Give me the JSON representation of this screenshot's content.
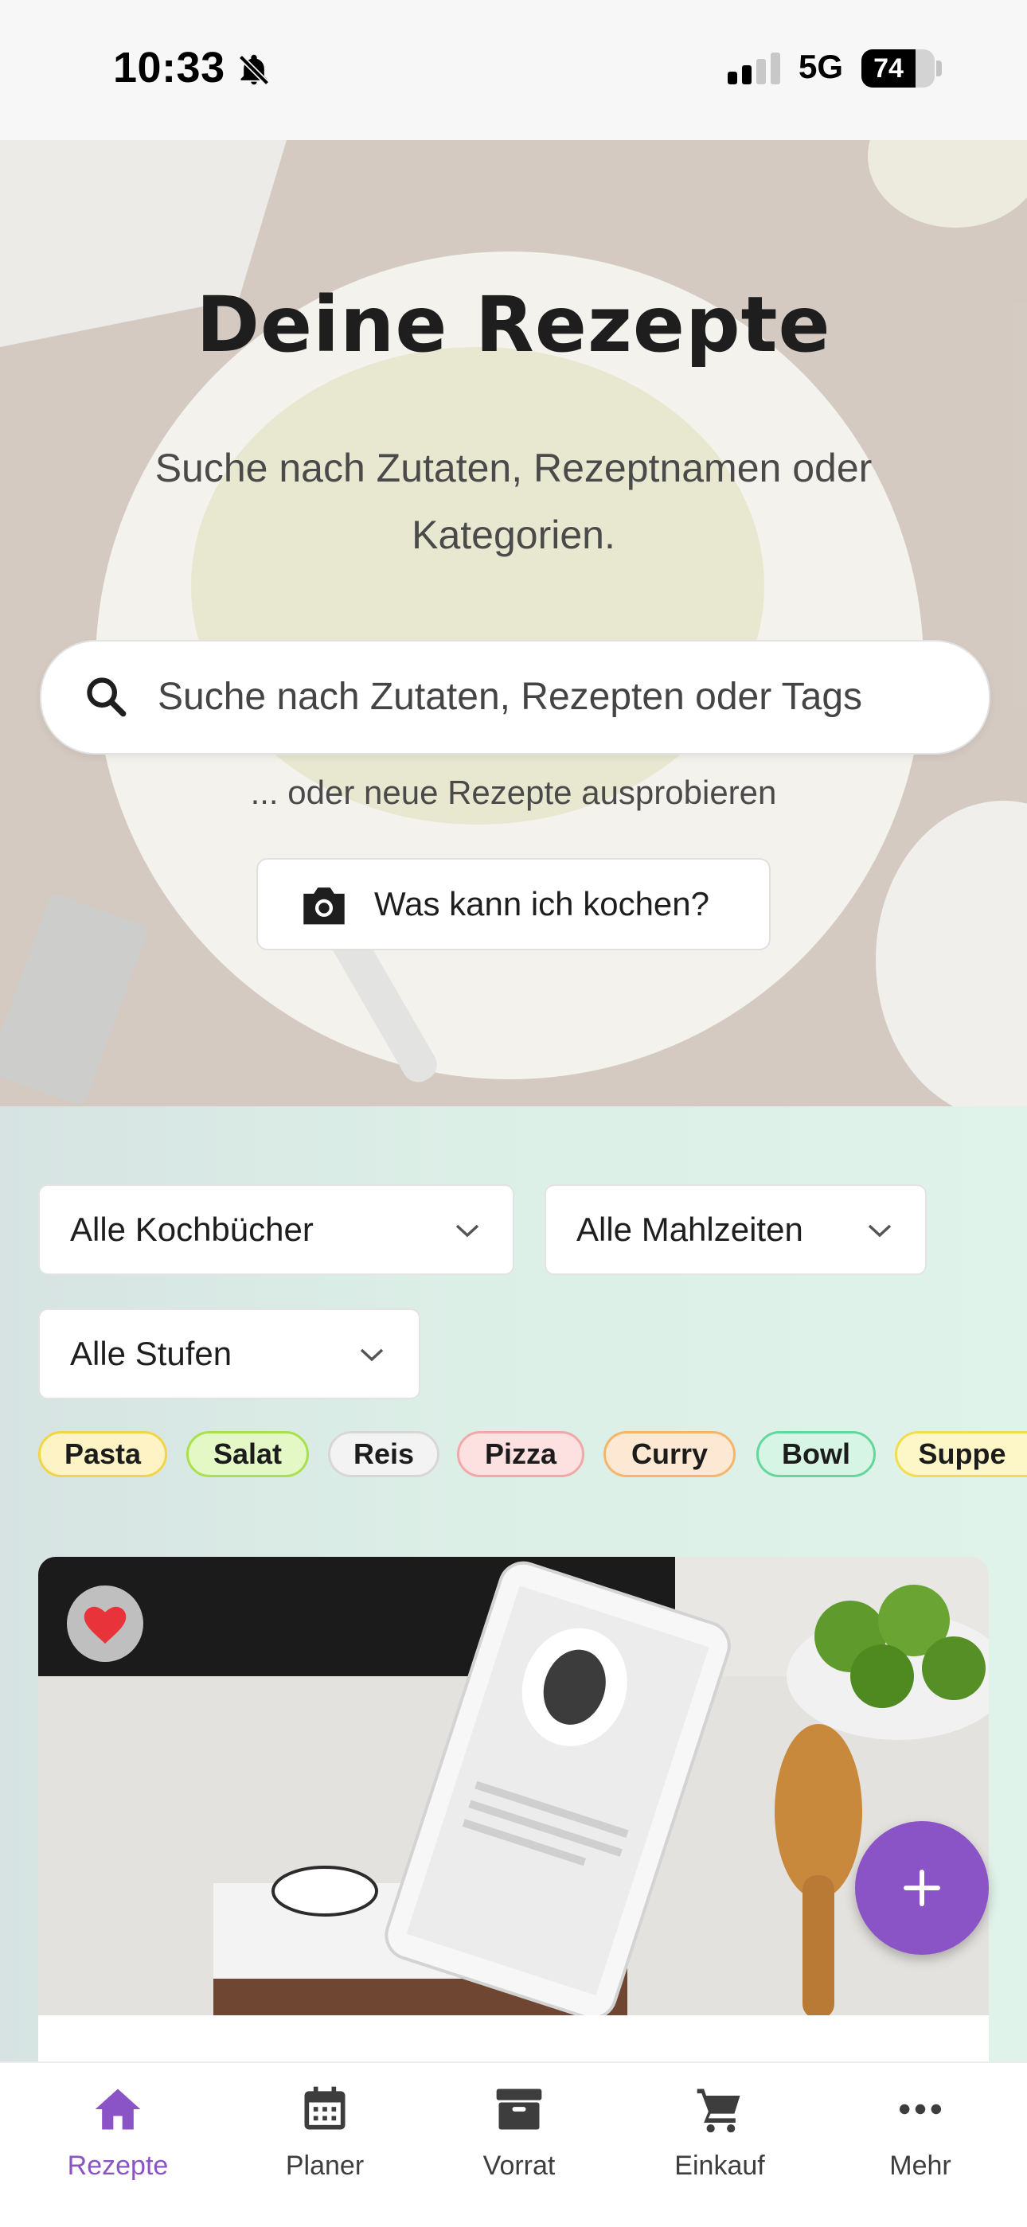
{
  "status_bar": {
    "time": "10:33",
    "network": "5G",
    "battery": "74",
    "battery_level": 0.74,
    "icons": [
      "bell-slash-icon",
      "signal-icon",
      "battery-icon"
    ]
  },
  "hero": {
    "title": "Deine Rezepte",
    "subtitle": "Suche nach Zutaten, Rezeptnamen oder Kategorien.",
    "search_placeholder": "Suche nach Zutaten, Rezepten oder Tags",
    "hint": "... oder neue Rezepte ausprobieren",
    "cook_button": "Was kann ich kochen?",
    "cook_icon": "camera-icon"
  },
  "filters": {
    "cookbooks": "Alle Kochbücher",
    "meals": "Alle Mahlzeiten",
    "levels": "Alle Stufen"
  },
  "chips": [
    {
      "label": "Pasta",
      "bg": "#fdf3c4",
      "border": "#f2d447"
    },
    {
      "label": "Salat",
      "bg": "#e3f8c4",
      "border": "#a9e04d"
    },
    {
      "label": "Reis",
      "bg": "#f3f3f3",
      "border": "#d7d7d7"
    },
    {
      "label": "Pizza",
      "bg": "#fde1e1",
      "border": "#f0a8a8"
    },
    {
      "label": "Curry",
      "bg": "#fde8d3",
      "border": "#f5b56a"
    },
    {
      "label": "Bowl",
      "bg": "#d6f5e5",
      "border": "#63d79c"
    },
    {
      "label": "Suppe",
      "bg": "#fdf6c6",
      "border": "#f3dd4f"
    }
  ],
  "card": {
    "favorite_icon": "heart-icon",
    "favorite": true
  },
  "fab_icon": "plus-icon",
  "nav": [
    {
      "label": "Rezepte",
      "icon": "home-icon",
      "active": true
    },
    {
      "label": "Planer",
      "icon": "calendar-icon",
      "active": false
    },
    {
      "label": "Vorrat",
      "icon": "archive-box-icon",
      "active": false
    },
    {
      "label": "Einkauf",
      "icon": "cart-icon",
      "active": false
    },
    {
      "label": "Mehr",
      "icon": "more-dots-icon",
      "active": false
    }
  ],
  "colors": {
    "accent": "#8b54c6",
    "heart": "#e8333a"
  }
}
